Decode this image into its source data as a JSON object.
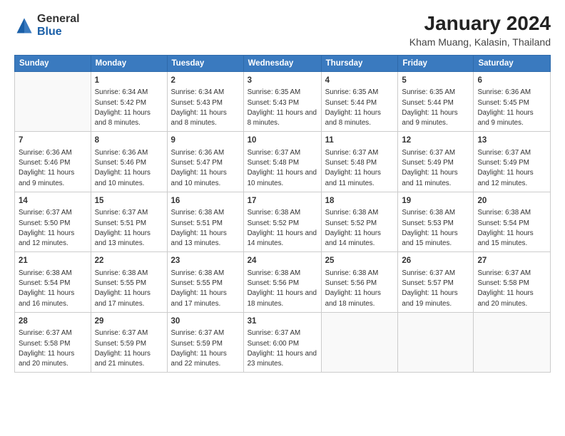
{
  "header": {
    "logo_general": "General",
    "logo_blue": "Blue",
    "main_title": "January 2024",
    "sub_title": "Kham Muang, Kalasin, Thailand"
  },
  "days_of_week": [
    "Sunday",
    "Monday",
    "Tuesday",
    "Wednesday",
    "Thursday",
    "Friday",
    "Saturday"
  ],
  "weeks": [
    [
      {
        "day": "",
        "sunrise": "",
        "sunset": "",
        "daylight": "",
        "empty": true
      },
      {
        "day": "1",
        "sunrise": "Sunrise: 6:34 AM",
        "sunset": "Sunset: 5:42 PM",
        "daylight": "Daylight: 11 hours and 8 minutes."
      },
      {
        "day": "2",
        "sunrise": "Sunrise: 6:34 AM",
        "sunset": "Sunset: 5:43 PM",
        "daylight": "Daylight: 11 hours and 8 minutes."
      },
      {
        "day": "3",
        "sunrise": "Sunrise: 6:35 AM",
        "sunset": "Sunset: 5:43 PM",
        "daylight": "Daylight: 11 hours and 8 minutes."
      },
      {
        "day": "4",
        "sunrise": "Sunrise: 6:35 AM",
        "sunset": "Sunset: 5:44 PM",
        "daylight": "Daylight: 11 hours and 8 minutes."
      },
      {
        "day": "5",
        "sunrise": "Sunrise: 6:35 AM",
        "sunset": "Sunset: 5:44 PM",
        "daylight": "Daylight: 11 hours and 9 minutes."
      },
      {
        "day": "6",
        "sunrise": "Sunrise: 6:36 AM",
        "sunset": "Sunset: 5:45 PM",
        "daylight": "Daylight: 11 hours and 9 minutes."
      }
    ],
    [
      {
        "day": "7",
        "sunrise": "Sunrise: 6:36 AM",
        "sunset": "Sunset: 5:46 PM",
        "daylight": "Daylight: 11 hours and 9 minutes."
      },
      {
        "day": "8",
        "sunrise": "Sunrise: 6:36 AM",
        "sunset": "Sunset: 5:46 PM",
        "daylight": "Daylight: 11 hours and 10 minutes."
      },
      {
        "day": "9",
        "sunrise": "Sunrise: 6:36 AM",
        "sunset": "Sunset: 5:47 PM",
        "daylight": "Daylight: 11 hours and 10 minutes."
      },
      {
        "day": "10",
        "sunrise": "Sunrise: 6:37 AM",
        "sunset": "Sunset: 5:48 PM",
        "daylight": "Daylight: 11 hours and 10 minutes."
      },
      {
        "day": "11",
        "sunrise": "Sunrise: 6:37 AM",
        "sunset": "Sunset: 5:48 PM",
        "daylight": "Daylight: 11 hours and 11 minutes."
      },
      {
        "day": "12",
        "sunrise": "Sunrise: 6:37 AM",
        "sunset": "Sunset: 5:49 PM",
        "daylight": "Daylight: 11 hours and 11 minutes."
      },
      {
        "day": "13",
        "sunrise": "Sunrise: 6:37 AM",
        "sunset": "Sunset: 5:49 PM",
        "daylight": "Daylight: 11 hours and 12 minutes."
      }
    ],
    [
      {
        "day": "14",
        "sunrise": "Sunrise: 6:37 AM",
        "sunset": "Sunset: 5:50 PM",
        "daylight": "Daylight: 11 hours and 12 minutes."
      },
      {
        "day": "15",
        "sunrise": "Sunrise: 6:37 AM",
        "sunset": "Sunset: 5:51 PM",
        "daylight": "Daylight: 11 hours and 13 minutes."
      },
      {
        "day": "16",
        "sunrise": "Sunrise: 6:38 AM",
        "sunset": "Sunset: 5:51 PM",
        "daylight": "Daylight: 11 hours and 13 minutes."
      },
      {
        "day": "17",
        "sunrise": "Sunrise: 6:38 AM",
        "sunset": "Sunset: 5:52 PM",
        "daylight": "Daylight: 11 hours and 14 minutes."
      },
      {
        "day": "18",
        "sunrise": "Sunrise: 6:38 AM",
        "sunset": "Sunset: 5:52 PM",
        "daylight": "Daylight: 11 hours and 14 minutes."
      },
      {
        "day": "19",
        "sunrise": "Sunrise: 6:38 AM",
        "sunset": "Sunset: 5:53 PM",
        "daylight": "Daylight: 11 hours and 15 minutes."
      },
      {
        "day": "20",
        "sunrise": "Sunrise: 6:38 AM",
        "sunset": "Sunset: 5:54 PM",
        "daylight": "Daylight: 11 hours and 15 minutes."
      }
    ],
    [
      {
        "day": "21",
        "sunrise": "Sunrise: 6:38 AM",
        "sunset": "Sunset: 5:54 PM",
        "daylight": "Daylight: 11 hours and 16 minutes."
      },
      {
        "day": "22",
        "sunrise": "Sunrise: 6:38 AM",
        "sunset": "Sunset: 5:55 PM",
        "daylight": "Daylight: 11 hours and 17 minutes."
      },
      {
        "day": "23",
        "sunrise": "Sunrise: 6:38 AM",
        "sunset": "Sunset: 5:55 PM",
        "daylight": "Daylight: 11 hours and 17 minutes."
      },
      {
        "day": "24",
        "sunrise": "Sunrise: 6:38 AM",
        "sunset": "Sunset: 5:56 PM",
        "daylight": "Daylight: 11 hours and 18 minutes."
      },
      {
        "day": "25",
        "sunrise": "Sunrise: 6:38 AM",
        "sunset": "Sunset: 5:56 PM",
        "daylight": "Daylight: 11 hours and 18 minutes."
      },
      {
        "day": "26",
        "sunrise": "Sunrise: 6:37 AM",
        "sunset": "Sunset: 5:57 PM",
        "daylight": "Daylight: 11 hours and 19 minutes."
      },
      {
        "day": "27",
        "sunrise": "Sunrise: 6:37 AM",
        "sunset": "Sunset: 5:58 PM",
        "daylight": "Daylight: 11 hours and 20 minutes."
      }
    ],
    [
      {
        "day": "28",
        "sunrise": "Sunrise: 6:37 AM",
        "sunset": "Sunset: 5:58 PM",
        "daylight": "Daylight: 11 hours and 20 minutes."
      },
      {
        "day": "29",
        "sunrise": "Sunrise: 6:37 AM",
        "sunset": "Sunset: 5:59 PM",
        "daylight": "Daylight: 11 hours and 21 minutes."
      },
      {
        "day": "30",
        "sunrise": "Sunrise: 6:37 AM",
        "sunset": "Sunset: 5:59 PM",
        "daylight": "Daylight: 11 hours and 22 minutes."
      },
      {
        "day": "31",
        "sunrise": "Sunrise: 6:37 AM",
        "sunset": "Sunset: 6:00 PM",
        "daylight": "Daylight: 11 hours and 23 minutes."
      },
      {
        "day": "",
        "sunrise": "",
        "sunset": "",
        "daylight": "",
        "empty": true
      },
      {
        "day": "",
        "sunrise": "",
        "sunset": "",
        "daylight": "",
        "empty": true
      },
      {
        "day": "",
        "sunrise": "",
        "sunset": "",
        "daylight": "",
        "empty": true
      }
    ]
  ]
}
